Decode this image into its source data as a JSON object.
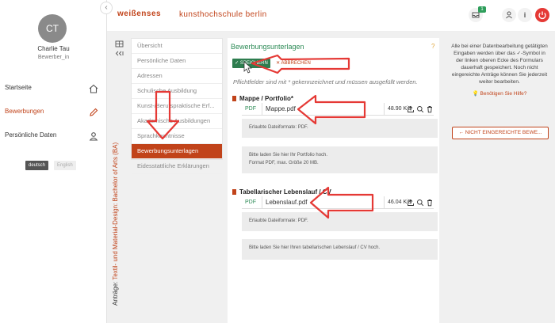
{
  "sidebar": {
    "collapse_glyph": "‹",
    "avatar_initials": "CT",
    "user_name": "Charlie Tau",
    "user_role": "Bewerber_in",
    "nav": [
      {
        "label": "Startseite",
        "icon": "home-icon"
      },
      {
        "label": "Bewerbungen",
        "icon": "pencil-icon"
      },
      {
        "label": "Persönliche Daten",
        "icon": "user-icon"
      }
    ],
    "lang_de": "deutsch",
    "lang_en": "English"
  },
  "header": {
    "logo": "weißenses",
    "school": "kunsthochschule berlin",
    "inbox_badge": "1",
    "info_glyph": "i"
  },
  "application": {
    "prefix": "Anträge:",
    "title": "Textil- und Material-Design: Bachelor of Arts (BA)"
  },
  "steps": [
    "Übersicht",
    "Persönliche Daten",
    "Adressen",
    "Schulische Ausbildung",
    "Kunst-/Berufspraktische Erf...",
    "Akademische Ausbildungen",
    "Sprachkenntnisse",
    "Bewerbungsunterlagen",
    "Eidesstattliche Erklärungen"
  ],
  "content": {
    "title": "Bewerbungsunterlagen",
    "help": "?",
    "save": "✓ SPEICHERN",
    "cancel": "✕ ABBRECHEN",
    "required_note": "Pflichtfelder sind mit * gekennzeichnet und müssen ausgefüllt werden.",
    "sections": [
      {
        "title": "Mappe / Portfolio*",
        "type": "PDF",
        "file": "Mappe.pdf",
        "size": "48.90 KiB",
        "formats": "Erlaubte Dateiformate: PDF.",
        "hint_line1": "Bitte laden Sie hier Ihr Portfolio hoch.",
        "hint_line2": "Format PDF, max. Größe 20 MB."
      },
      {
        "title": "Tabellarischer Lebenslauf / CV",
        "type": "PDF",
        "file": "Lebenslauf.pdf",
        "size": "46.04 KiB",
        "formats": "Erlaubte Dateiformate: PDF.",
        "hint_line1": "Bitte laden Sie hier Ihren tabellarischen Lebenslauf / CV hoch."
      }
    ]
  },
  "right_panel": {
    "info": "Alle bei einer Datenbearbeitung getätigten Eingaben werden über das ✓-Symbol in der linken oberen Ecke des Formulars dauerhaft gespeichert. Noch nicht eingereichte Anträge können Sie jederzeit weiter bearbeiten.",
    "help_link": "Benötigen Sie Hilfe?",
    "not_submitted": "← NICHT EINGEREICHTE BEWE..."
  },
  "colors": {
    "accent": "#c1431a",
    "green": "#2e7d4f",
    "arrow": "#e53935"
  }
}
